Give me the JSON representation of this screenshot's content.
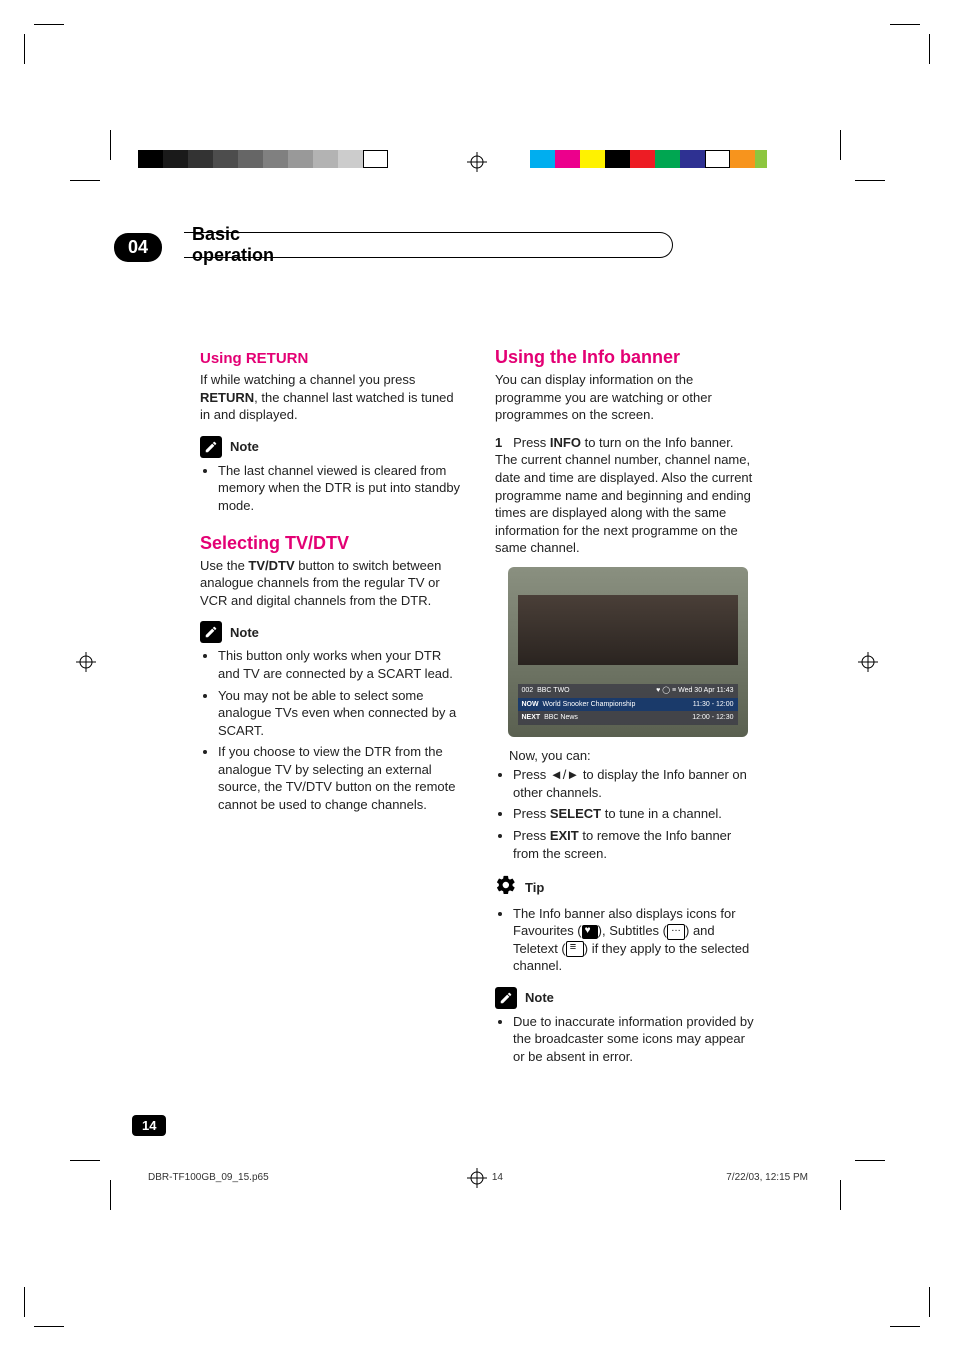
{
  "chapter_number": "04",
  "chapter_title": "Basic operation",
  "page_number": "14",
  "left": {
    "h_using_return": "Using RETURN",
    "p_return": "If while watching a channel you press RETURN, the channel last watched is tuned in and displayed.",
    "return_bold": "RETURN",
    "note_label": "Note",
    "note1_items": [
      "The last channel viewed is cleared from memory when the DTR is put into standby mode."
    ],
    "h_selecting": "Selecting TV/DTV",
    "p_selecting": "Use the TV/DTV button to switch between analogue channels from the regular TV or VCR and digital channels from the DTR.",
    "selecting_bold": "TV/DTV",
    "note2_items": [
      "This button only works when your DTR and TV are connected by a SCART lead.",
      "You may not be able to select some analogue TVs even when connected by a SCART.",
      "If you choose to view the DTR from the analogue TV by selecting an external source, the TV/DTV button on the remote cannot be used to change channels."
    ]
  },
  "right": {
    "h_info": "Using the Info banner",
    "p_info_intro": "You can display information on the programme you are watching or other programmes on the screen.",
    "step1_num": "1",
    "step1_text": "Press INFO to turn on the Info banner.",
    "step1_bold": "INFO",
    "step1_follow": "The current channel number, channel name, date and time are displayed. Also the current programme name and beginning and ending times are displayed along with the same information for the next programme on the same channel.",
    "tv": {
      "ch": "002",
      "name": "BBC TWO",
      "date": "Wed 30 Apr 11:43",
      "now_label": "NOW",
      "now_prog": "World Snooker Championship",
      "now_time": "11:30 - 12:00",
      "next_label": "NEXT",
      "next_prog": "BBC News",
      "next_time": "12:00 - 12:30"
    },
    "now_you_can": "Now, you can:",
    "actions": [
      "Press ◄/► to display the Info banner on other channels.",
      "Press SELECT to tune in a channel.",
      "Press EXIT to remove the Info banner from the screen."
    ],
    "tip_label": "Tip",
    "tip_text_pre": "The Info banner also displays icons for Favourites (",
    "tip_text_mid1": "), Subtitles (",
    "tip_text_mid2": ") and Teletext (",
    "tip_text_post": ") if they apply to the selected channel.",
    "note_label": "Note",
    "note_items": [
      "Due to inaccurate information provided by the broadcaster some icons may appear or be absent in error."
    ]
  },
  "footer": {
    "file": "DBR-TF100GB_09_15.p65",
    "page": "14",
    "timestamp": "7/22/03, 12:15 PM"
  },
  "print": {
    "gray_bars": [
      "#000",
      "#1a1a1a",
      "#333",
      "#4d4d4d",
      "#666",
      "#808080",
      "#999",
      "#b3b3b3",
      "#ccc",
      "#fff"
    ],
    "color_bars": [
      "#00aeef",
      "#ec008c",
      "#fff200",
      "#000",
      "#ed1c24",
      "#00a651",
      "#2e3192",
      "#f7941d",
      "#92278f",
      "#8dc63f"
    ]
  }
}
